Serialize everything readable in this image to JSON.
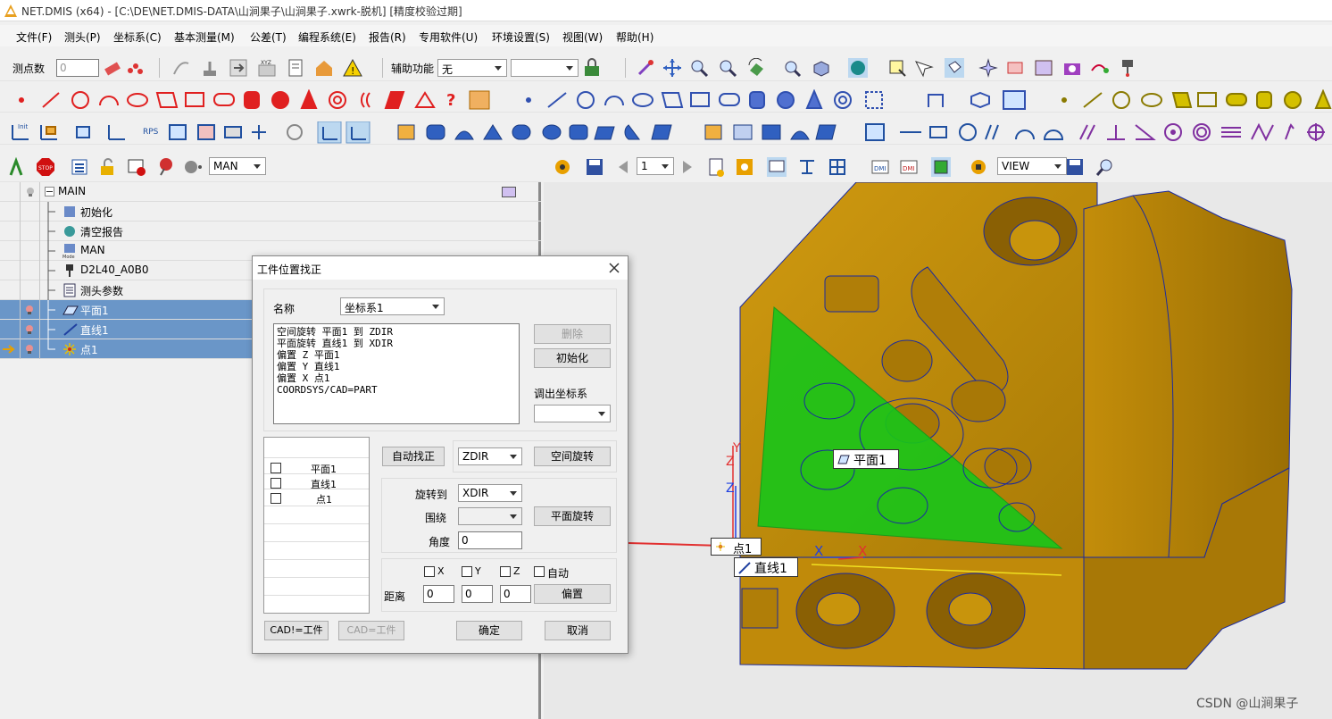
{
  "titlebar": {
    "title": "NET.DMIS (x64) - [C:\\DE\\NET.DMIS-DATA\\山涧果子\\山涧果子.xwrk-脱机] [精度校验过期]"
  },
  "menu": [
    "文件(F)",
    "测头(P)",
    "坐标系(C)",
    "基本测量(M)",
    "公差(T)",
    "编程系统(E)",
    "报告(R)",
    "专用软件(U)",
    "环境设置(S)",
    "视图(W)",
    "帮助(H)"
  ],
  "toolbar1": {
    "points_label": "测点数",
    "points_value": "0",
    "aux_label": "辅助功能",
    "aux_value": "无",
    "aux2_value": ""
  },
  "toolbar_row4": {
    "mode_value": "MAN"
  },
  "viewtb": {
    "page_value": "1",
    "view_value": "VIEW"
  },
  "tree": {
    "root": "MAIN",
    "items": [
      {
        "label": "初始化",
        "selected": false
      },
      {
        "label": "清空报告",
        "selected": false
      },
      {
        "label": "MAN",
        "selected": false
      },
      {
        "label": "D2L40_A0B0",
        "selected": false
      },
      {
        "label": "测头参数",
        "selected": false
      },
      {
        "label": "平面1",
        "selected": true
      },
      {
        "label": "直线1",
        "selected": true
      },
      {
        "label": "点1",
        "selected": true
      }
    ]
  },
  "dialog": {
    "title": "工件位置找正",
    "name_label": "名称",
    "name_value": "坐标系1",
    "script_lines": [
      "空间旋转 平面1 到 ZDIR",
      "平面旋转 直线1 到 XDIR",
      "偏置 Z 平面1",
      "偏置 Y 直线1",
      "偏置 X 点1",
      "COORDSYS/CAD=PART"
    ],
    "delete_btn": "删除",
    "init_btn": "初始化",
    "recall_label": "调出坐标系",
    "recall_value": "",
    "features": [
      "平面1",
      "直线1",
      "点1"
    ],
    "auto_align_btn": "自动找正",
    "space_dir": "ZDIR",
    "space_rotate_btn": "空间旋转",
    "rotate_to_label": "旋转到",
    "rotate_to_value": "XDIR",
    "around_label": "围绕",
    "around_value": "",
    "plane_rotate_btn": "平面旋转",
    "angle_label": "角度",
    "angle_value": "0",
    "axis_x": "X",
    "axis_y": "Y",
    "axis_z": "Z",
    "auto_label": "自动",
    "distance_label": "距离",
    "dist_x": "0",
    "dist_y": "0",
    "dist_z": "0",
    "offset_btn": "偏置",
    "cad_to_part_btn": "CAD!=工件",
    "cad_eq_part_btn": "CAD=工件",
    "ok_btn": "确定",
    "cancel_btn": "取消"
  },
  "viewport": {
    "plane_label": "平面1",
    "point_label": "点1",
    "line_label": "直线1",
    "axis_x": "X",
    "axis_y": "Y",
    "axis_z": "Z",
    "watermark": "CSDN @山涧果子"
  },
  "colors": {
    "part": "#b8860b",
    "plane": "#19c419",
    "selection": "#6a96c8",
    "axis_red": "#e23030",
    "axis_blue": "#2040e0"
  }
}
